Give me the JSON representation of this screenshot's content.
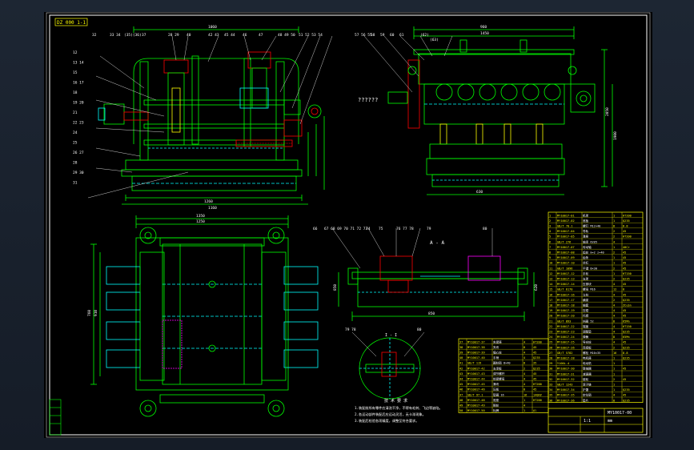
{
  "drawing": {
    "title_tag": "DZ 000 1-1",
    "section_label": "A - A",
    "detail_label": "I - I",
    "view_label_left": "??????",
    "drawing_no": "MY10017-00",
    "scale_text": "1:1",
    "unit_text": "mm",
    "notes_title": "技 术 要 求",
    "notes": [
      "1.装配前所有零件应清洗干净，不得有毛刺、飞边等缺陷。",
      "2.各运动部件装配后应运动灵活，无卡滞现象。",
      "3.装配后检验各项精度，调整至符合要求。"
    ]
  },
  "callouts_top_left": [
    "32",
    "33 34",
    "(35)(36)",
    "37",
    "28 29",
    "40",
    "42 43",
    "45 44",
    "46",
    "47",
    "48 49 50",
    "51 52 53 54"
  ],
  "callouts_left": [
    "12",
    "13 14",
    "15",
    "16 17",
    "18",
    "19 20",
    "21",
    "22 23",
    "24",
    "25",
    "26 27",
    "28",
    "29 30",
    "31"
  ],
  "callouts_top_right": [
    "57 56 55",
    "58",
    "59",
    "60",
    "61",
    "(62)",
    "(63)"
  ],
  "callouts_section": [
    "66",
    "67 68 69 70 71 72 73",
    "74",
    "75",
    "76 77 78",
    "79",
    "80"
  ],
  "callouts_detail": [
    "79 78",
    "80"
  ],
  "dimensions": [
    "1260",
    "1160",
    "1060",
    "960",
    "1450",
    "1350",
    "1250",
    "2050",
    "1900",
    "630",
    "850",
    "760",
    "910",
    "850",
    "620"
  ],
  "parts_table": {
    "rows": [
      [
        "1",
        "MY10017-01",
        "机架",
        "1",
        "HT200"
      ],
      [
        "2",
        "MY10017-02",
        "底板",
        "1",
        "Q235"
      ],
      [
        "3",
        "GB/T 70.1",
        "螺钉 M12×40",
        "8",
        "8.8"
      ],
      [
        "4",
        "MY10017-04",
        "导轨",
        "2",
        "45"
      ],
      [
        "5",
        "MY10017-05",
        "滑座",
        "2",
        "HT200"
      ],
      [
        "6",
        "GB/T 276",
        "轴承 6205",
        "4",
        ""
      ],
      [
        "7",
        "MY10017-07",
        "传动轴",
        "1",
        "40Cr"
      ],
      [
        "8",
        "MY10017-08",
        "齿轮 m=2 z=40",
        "2",
        "45"
      ],
      [
        "9",
        "MY10017-09",
        "齿条",
        "1",
        "45"
      ],
      [
        "10",
        "MY10017-10",
        "丝杠",
        "1",
        "45"
      ],
      [
        "11",
        "GB/T 1096",
        "平键 8×30",
        "2",
        "45"
      ],
      [
        "12",
        "MY10017-12",
        "手轮",
        "1",
        "HT150"
      ],
      [
        "13",
        "MY10017-13",
        "支架",
        "2",
        "Q235"
      ],
      [
        "14",
        "MY10017-14",
        "压紧块",
        "4",
        "45"
      ],
      [
        "15",
        "GB/T 6170",
        "螺母 M16",
        "12",
        "8"
      ],
      [
        "16",
        "MY10017-16",
        "立柱",
        "4",
        "45"
      ],
      [
        "17",
        "MY10017-17",
        "横梁",
        "2",
        "Q235"
      ],
      [
        "18",
        "MY10017-18",
        "轴套",
        "4",
        "ZCuSn"
      ],
      [
        "19",
        "MY10017-19",
        "压辊",
        "4",
        "45"
      ],
      [
        "20",
        "MY10017-20",
        "托辊",
        "4",
        "45"
      ],
      [
        "21",
        "GB/T 893",
        "挡圈 52",
        "8",
        "65Mn"
      ],
      [
        "22",
        "MY10017-22",
        "端盖",
        "4",
        "HT150"
      ],
      [
        "23",
        "MY10017-23",
        "调整垫",
        "4",
        "Q235"
      ],
      [
        "24",
        "MY10017-24",
        "弹簧",
        "8",
        "65Mn"
      ],
      [
        "25",
        "MY10017-25",
        "导向轮",
        "4",
        "45"
      ],
      [
        "26",
        "MY10017-26",
        "连接板",
        "2",
        "Q235"
      ],
      [
        "27",
        "GB/T 5782",
        "螺栓 M10×35",
        "16",
        "8.8"
      ],
      [
        "28",
        "MY10017-28",
        "电机座",
        "1",
        "Q235"
      ],
      [
        "29",
        "Y100L-4",
        "电动机",
        "1",
        ""
      ],
      [
        "30",
        "MY10017-30",
        "联轴器",
        "1",
        "45"
      ],
      [
        "31",
        "MY10017-31",
        "减速器",
        "1",
        ""
      ],
      [
        "32",
        "MY10017-32",
        "链轮",
        "2",
        "45"
      ],
      [
        "33",
        "GB/T 1243",
        "滚子链",
        "1",
        ""
      ],
      [
        "34",
        "MY10017-34",
        "护罩",
        "1",
        "Q235"
      ],
      [
        "35",
        "MY10017-35",
        "定位销",
        "4",
        "45"
      ],
      [
        "36",
        "MY10017-36",
        "垫片",
        "8",
        "Q235"
      ]
    ],
    "lower_rows": [
      [
        "37",
        "MY10017-37",
        "夹紧座",
        "4",
        "HT200"
      ],
      [
        "38",
        "MY10017-38",
        "夹块",
        "8",
        "45"
      ],
      [
        "39",
        "MY10017-39",
        "偏心轮",
        "4",
        "45"
      ],
      [
        "40",
        "MY10017-40",
        "手柄",
        "4",
        "Q235"
      ],
      [
        "41",
        "GB/T 119",
        "圆柱销 8×40",
        "8",
        "35"
      ],
      [
        "42",
        "MY10017-42",
        "支承板",
        "2",
        "Q235"
      ],
      [
        "43",
        "MY10017-43",
        "调节螺杆",
        "4",
        "45"
      ],
      [
        "44",
        "MY10017-44",
        "锁紧螺母",
        "4",
        "45"
      ],
      [
        "45",
        "MY10017-45",
        "滑块",
        "4",
        "HT200"
      ],
      [
        "46",
        "MY10017-46",
        "压板",
        "8",
        "45"
      ],
      [
        "47",
        "GB/T 97.1",
        "垫圈 16",
        "16",
        "140HV"
      ],
      [
        "48",
        "MY10017-48",
        "底座",
        "1",
        "HT200"
      ],
      [
        "49",
        "MY10017-49",
        "脚轮",
        "4",
        ""
      ],
      [
        "50",
        "MY10017-50",
        "标牌",
        "1",
        "Al"
      ]
    ]
  },
  "colors": {
    "background": "#000000",
    "border": "#ffffff",
    "part": "#00ff00",
    "hidden": "#00ffff",
    "dimension": "#00ff00",
    "accent": "#ff0000",
    "label": "#ffff00",
    "section": "#ff00ff"
  }
}
